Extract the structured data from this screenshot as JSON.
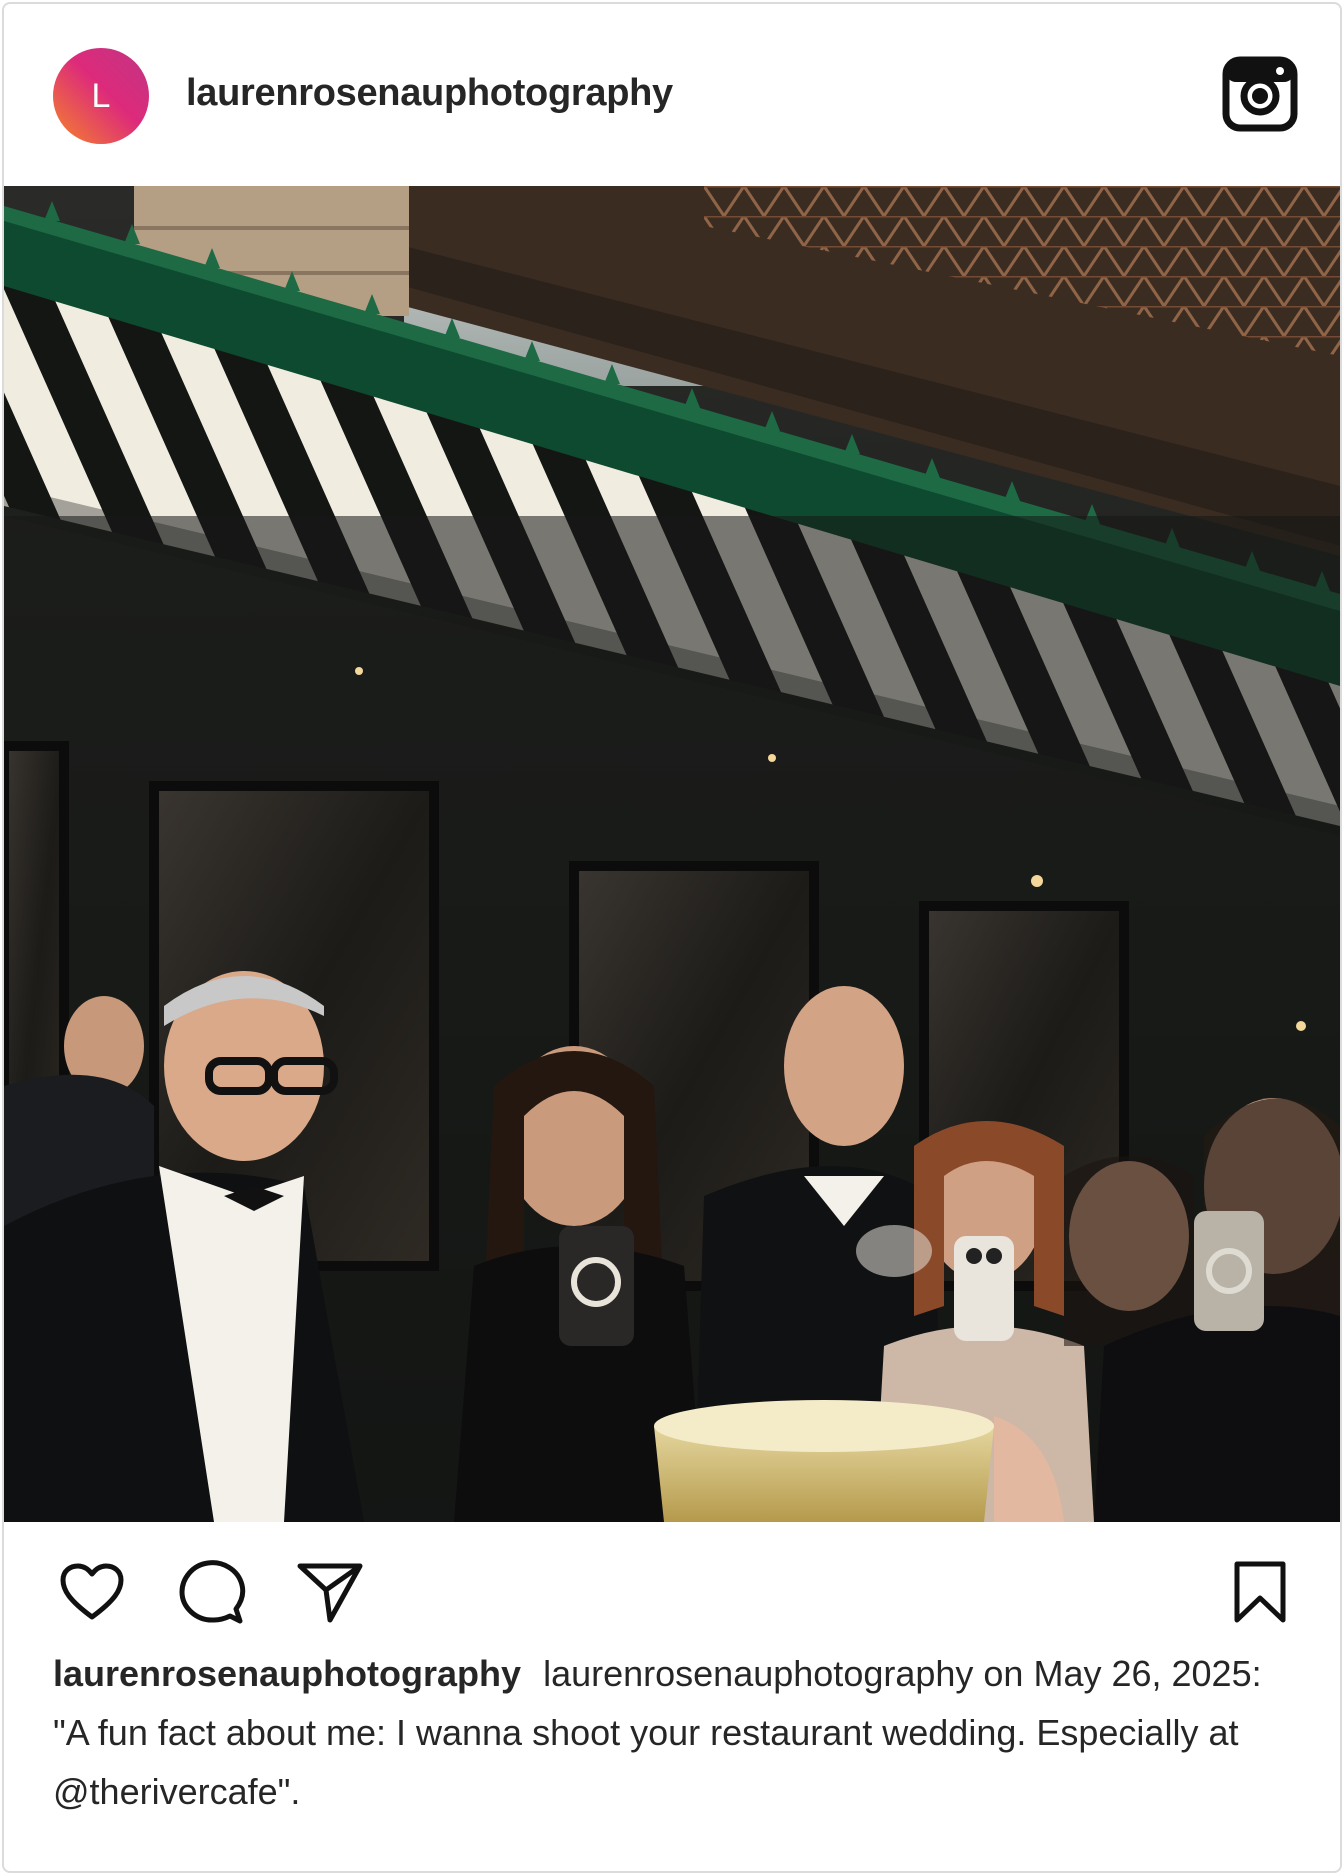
{
  "post": {
    "avatar_letter": "L",
    "username": "laurenrosenauphotography",
    "caption_username": "laurenrosenauphotography",
    "caption_text": "laurenrosenauphotography on May 26, 2025: \"A fun fact about me: I wanna shoot your restaurant wedding. Especially at @therivercafe\"."
  },
  "icons": {
    "header_right": "instagram-icon",
    "actions": [
      "heart-icon",
      "comment-icon",
      "share-icon"
    ],
    "save": "bookmark-icon"
  },
  "colors": {
    "avatar_gradient_start": "#f58529",
    "avatar_gradient_end": "#c13584",
    "awning_green": "#0e4a30",
    "text": "#262626"
  }
}
